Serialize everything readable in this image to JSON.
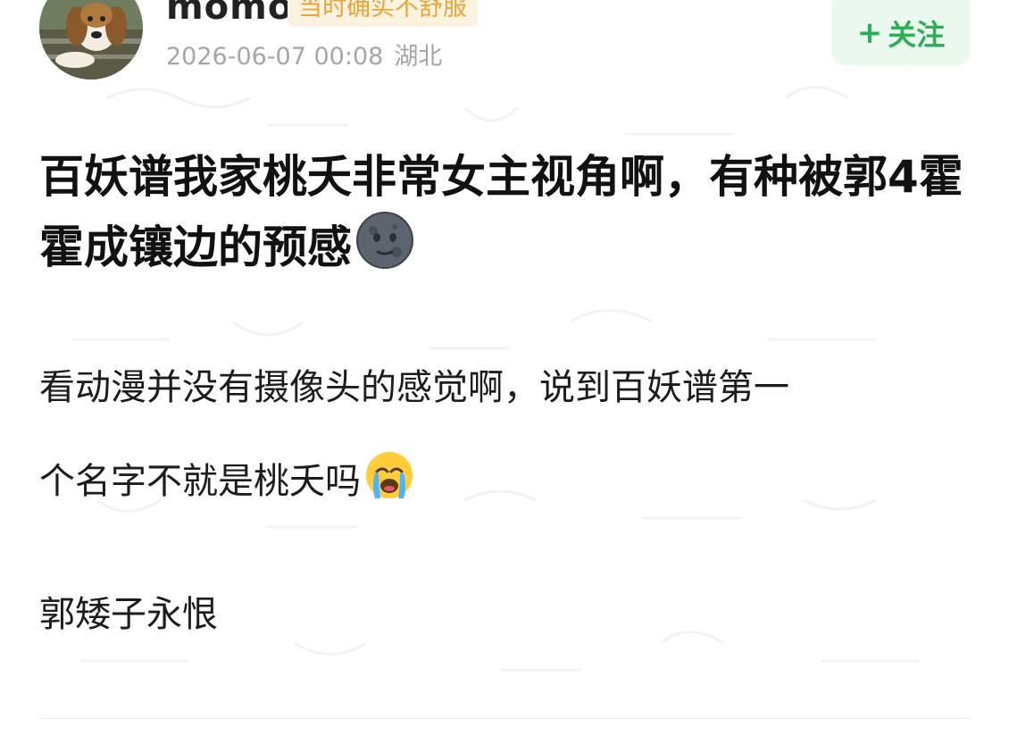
{
  "post": {
    "author": {
      "name": "momo",
      "tag": "当时确实不舒服",
      "avatar": "beagle-dog-avatar"
    },
    "timestamp": "2026-06-07 00:08",
    "location": "湖北",
    "follow_label": "关注",
    "follow_icon": "+",
    "title": "百妖谱我家桃夭非常女主视角啊，有种被郭4霍霍成镶边的预感",
    "title_emoji": "new-moon-face-emoji",
    "body_line_1": "看动漫并没有摄像头的感觉啊，说到百妖谱第一",
    "body_line_2": "个名字不就是桃夭吗",
    "body_line_2_emoji": "loudly-crying-face-emoji",
    "body_line_3": "郭矮子永恨"
  },
  "colors": {
    "follow_green": "#2aae56",
    "follow_bg": "#eaf8ee",
    "tag_orange": "#e9a43a",
    "tag_bg": "#fbf3e0",
    "meta_gray": "#a6a6a6"
  }
}
